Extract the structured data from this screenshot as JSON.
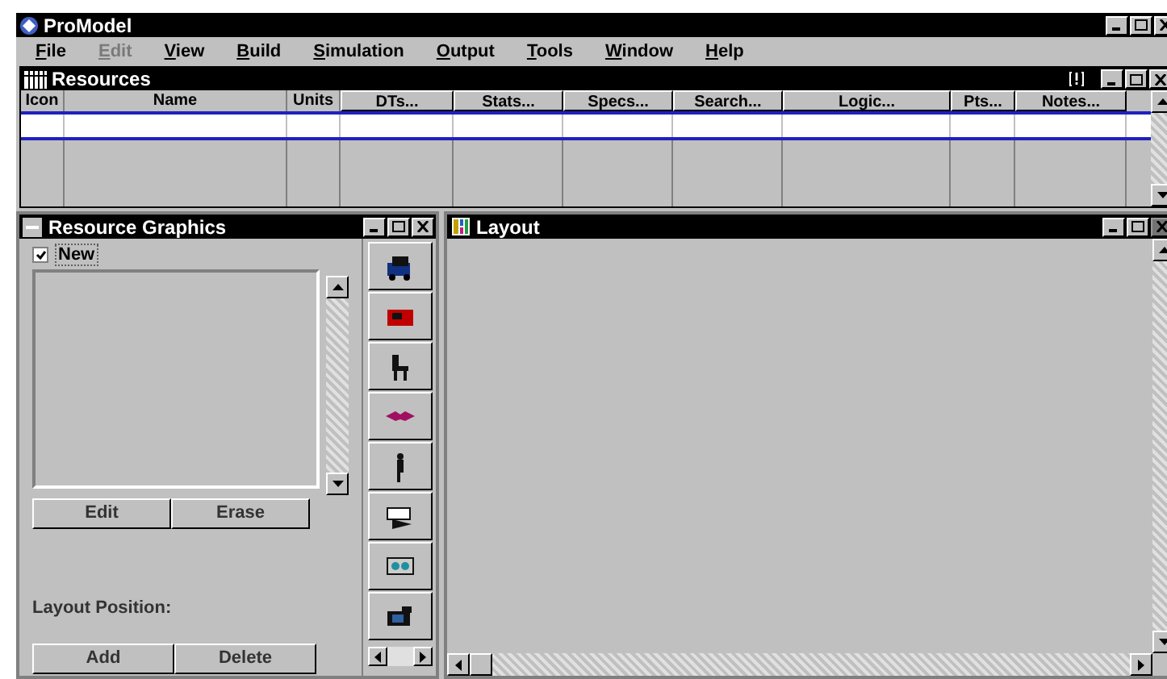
{
  "window": {
    "title": "ProModel"
  },
  "menu": [
    {
      "label": "File",
      "disabled": false
    },
    {
      "label": "Edit",
      "disabled": true
    },
    {
      "label": "View",
      "disabled": false
    },
    {
      "label": "Build",
      "disabled": false
    },
    {
      "label": "Simulation",
      "disabled": false
    },
    {
      "label": "Output",
      "disabled": false
    },
    {
      "label": "Tools",
      "disabled": false
    },
    {
      "label": "Window",
      "disabled": false
    },
    {
      "label": "Help",
      "disabled": false
    }
  ],
  "resources": {
    "title": "Resources",
    "columns": [
      {
        "label": "Icon",
        "kind": "label"
      },
      {
        "label": "Name",
        "kind": "label"
      },
      {
        "label": "Units",
        "kind": "label"
      },
      {
        "label": "DTs...",
        "kind": "button"
      },
      {
        "label": "Stats...",
        "kind": "button"
      },
      {
        "label": "Specs...",
        "kind": "button"
      },
      {
        "label": "Search...",
        "kind": "button"
      },
      {
        "label": "Logic...",
        "kind": "button"
      },
      {
        "label": "Pts...",
        "kind": "button"
      },
      {
        "label": "Notes...",
        "kind": "button"
      }
    ]
  },
  "resource_graphics": {
    "title": "Resource Graphics",
    "new_checkbox": {
      "label": "New",
      "checked": true
    },
    "buttons": [
      "Edit",
      "Erase"
    ],
    "position_label": "Layout Position:",
    "position_buttons": [
      "Add",
      "Delete"
    ]
  },
  "layout": {
    "title": "Layout"
  }
}
